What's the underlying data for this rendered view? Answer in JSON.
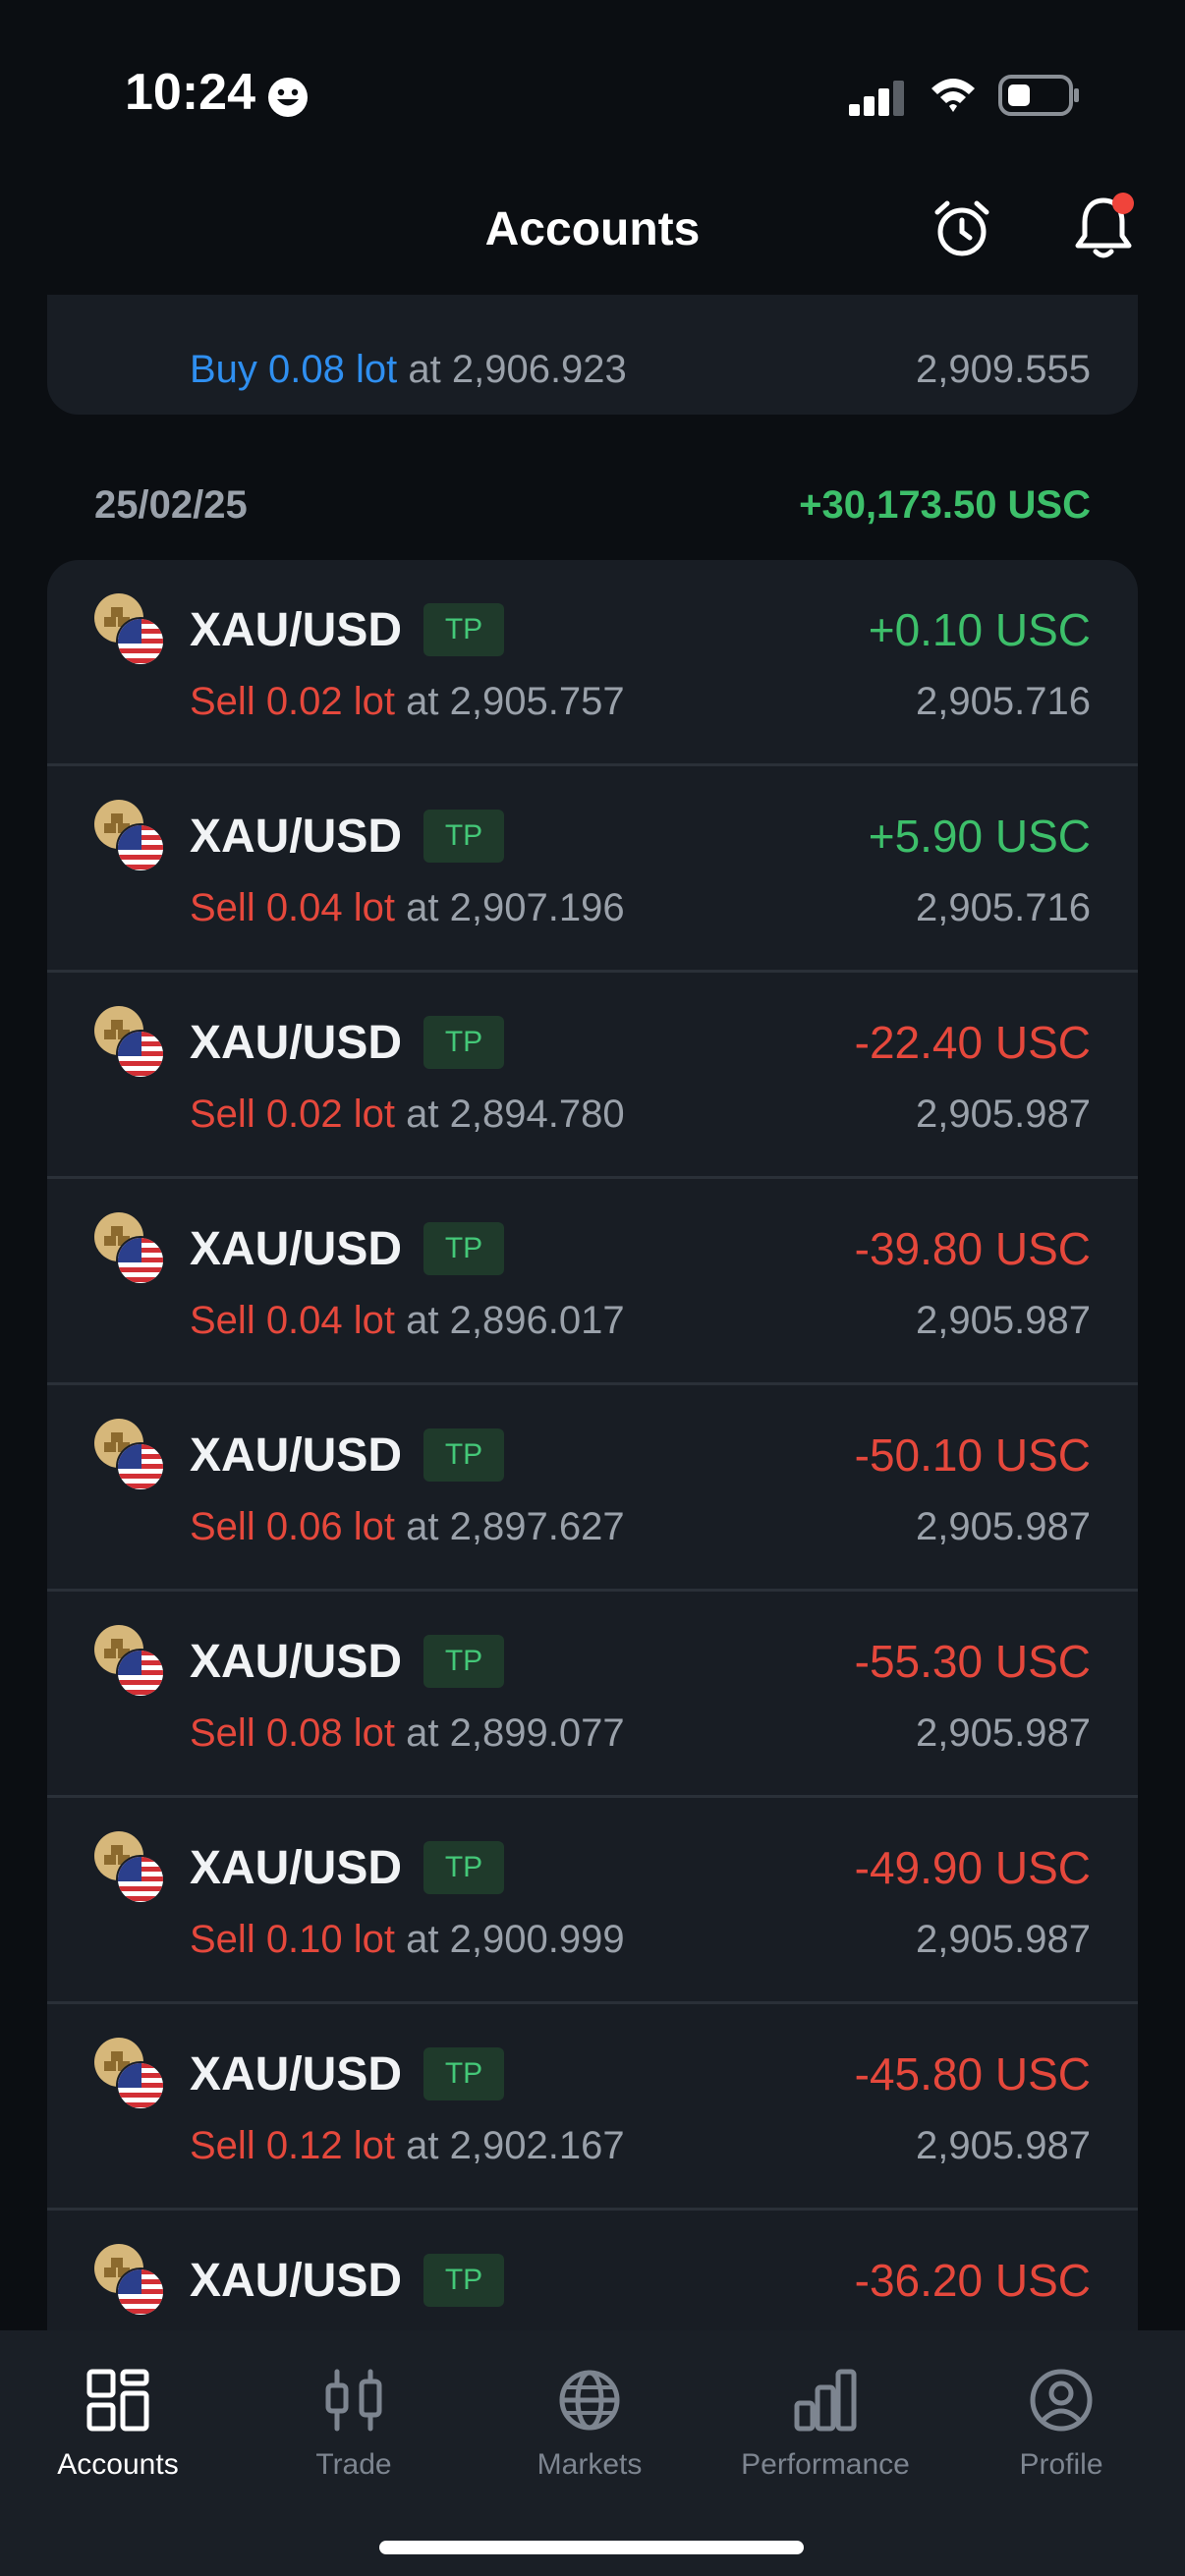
{
  "status": {
    "time": "10:24"
  },
  "header": {
    "title": "Accounts"
  },
  "top_card": {
    "side": "Buy 0.08 lot",
    "at_label": " at ",
    "open_price": "2,906.923",
    "current_price": "2,909.555"
  },
  "date_group": {
    "date": "25/02/25",
    "total": "+30,173.50 USC"
  },
  "trades": [
    {
      "symbol": "XAU/USD",
      "badge": "TP",
      "pnl": "+0.10 USC",
      "pnl_type": "pos",
      "side": "Sell 0.02 lot",
      "at": " at 2,905.757",
      "current": "2,905.716"
    },
    {
      "symbol": "XAU/USD",
      "badge": "TP",
      "pnl": "+5.90 USC",
      "pnl_type": "pos",
      "side": "Sell 0.04 lot",
      "at": " at 2,907.196",
      "current": "2,905.716"
    },
    {
      "symbol": "XAU/USD",
      "badge": "TP",
      "pnl": "-22.40 USC",
      "pnl_type": "neg",
      "side": "Sell 0.02 lot",
      "at": " at 2,894.780",
      "current": "2,905.987"
    },
    {
      "symbol": "XAU/USD",
      "badge": "TP",
      "pnl": "-39.80 USC",
      "pnl_type": "neg",
      "side": "Sell 0.04 lot",
      "at": " at 2,896.017",
      "current": "2,905.987"
    },
    {
      "symbol": "XAU/USD",
      "badge": "TP",
      "pnl": "-50.10 USC",
      "pnl_type": "neg",
      "side": "Sell 0.06 lot",
      "at": " at 2,897.627",
      "current": "2,905.987"
    },
    {
      "symbol": "XAU/USD",
      "badge": "TP",
      "pnl": "-55.30 USC",
      "pnl_type": "neg",
      "side": "Sell 0.08 lot",
      "at": " at 2,899.077",
      "current": "2,905.987"
    },
    {
      "symbol": "XAU/USD",
      "badge": "TP",
      "pnl": "-49.90 USC",
      "pnl_type": "neg",
      "side": "Sell 0.10 lot",
      "at": " at 2,900.999",
      "current": "2,905.987"
    },
    {
      "symbol": "XAU/USD",
      "badge": "TP",
      "pnl": "-45.80 USC",
      "pnl_type": "neg",
      "side": "Sell 0.12 lot",
      "at": " at 2,902.167",
      "current": "2,905.987"
    },
    {
      "symbol": "XAU/USD",
      "badge": "TP",
      "pnl": "-36.20 USC",
      "pnl_type": "neg",
      "side": "",
      "at": "",
      "current": ""
    }
  ],
  "tabs": [
    {
      "label": "Accounts",
      "icon": "grid-icon",
      "active": true
    },
    {
      "label": "Trade",
      "icon": "candles-icon",
      "active": false
    },
    {
      "label": "Markets",
      "icon": "globe-icon",
      "active": false
    },
    {
      "label": "Performance",
      "icon": "bar-chart-icon",
      "active": false
    },
    {
      "label": "Profile",
      "icon": "profile-icon",
      "active": false
    }
  ],
  "colors": {
    "background": "#0b0e12",
    "card": "#181d24",
    "positive": "#3dbf6a",
    "negative": "#e5483c",
    "buy": "#2f8ff0",
    "badge_bg": "#1f3a2b",
    "notification_dot": "#f0443b"
  }
}
